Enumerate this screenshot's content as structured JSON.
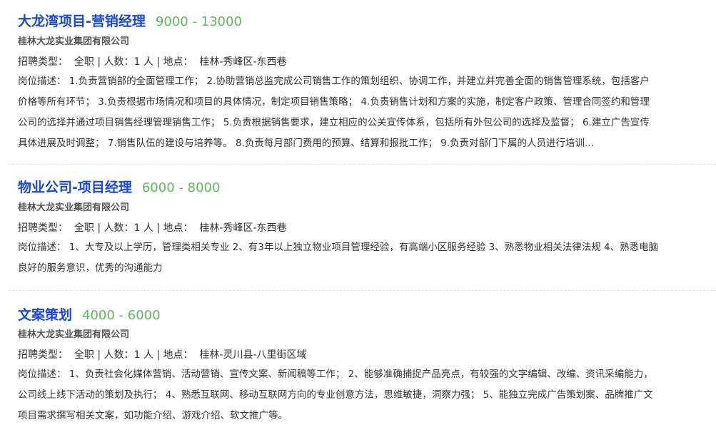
{
  "labels": {
    "type_label": "招聘类型：",
    "count_label": "人数：",
    "location_label": "地点：",
    "desc_label": "岗位描述："
  },
  "jobs": [
    {
      "title": "大龙湾项目-营销经理",
      "salary": "9000 - 13000",
      "company": "桂林大龙实业集团有限公司",
      "employment_type": "全职",
      "headcount": "1 人",
      "location": "桂林-秀峰区-东西巷",
      "desc_lines": [
        "1.负责营销部的全面管理工作；  2.协助营销总监完成公司销售工作的策划组织、协调工作，并建立并完善全面的销售管理系统，包括客户",
        "价格等所有环节；  3.负责根据市场情况和项目的具体情况，制定项目销售策略；  4.负责销售计划和方案的实施，制定客户政策、管理合同签约和管理",
        "公司的选择并通过项目销售经理管理销售工作；  5.负责根据销售要求，建立相应的公关宣传体系，包括所有外包公司的选择及监督；  6.建立广告宣传",
        "具体进展及时调整；  7.销售队伍的建设与培养等。  8.负责每月部门费用的预算、结算和报批工作；  9.负责对部门下属的人员进行培训..."
      ]
    },
    {
      "title": "物业公司-项目经理",
      "salary": "6000 - 8000",
      "company": "桂林大龙实业集团有限公司",
      "employment_type": "全职",
      "headcount": "1 人",
      "location": "桂林-秀峰区-东西巷",
      "desc_lines": [
        "1、大专及以上学历，管理类相关专业 2、有3年以上独立物业项目管理经验，有高端小区服务经验 3、熟悉物业相关法律法规 4、熟悉电脑",
        "良好的服务意识，优秀的沟通能力"
      ]
    },
    {
      "title": "文案策划",
      "salary": "4000 - 6000",
      "company": "桂林大龙实业集团有限公司",
      "employment_type": "全职",
      "headcount": "1 人",
      "location": "桂林-灵川县-八里街区域",
      "desc_lines": [
        "1、负责社会化媒体营销、活动营销、宣传文案、新闻稿等工作；  2、能够准确捕捉产品亮点，有较强的文字编辑、改编、资讯采编能力，",
        "公司线上线下活动的策划及执行；  4、熟悉互联网、移动互联网方向的专业创意方法，思维敏捷，洞察力强；  5、能独立完成广告策划案、品牌推广文",
        "项目需求撰写相关文案，如功能介绍、游戏介绍、软文推广等。"
      ]
    }
  ]
}
